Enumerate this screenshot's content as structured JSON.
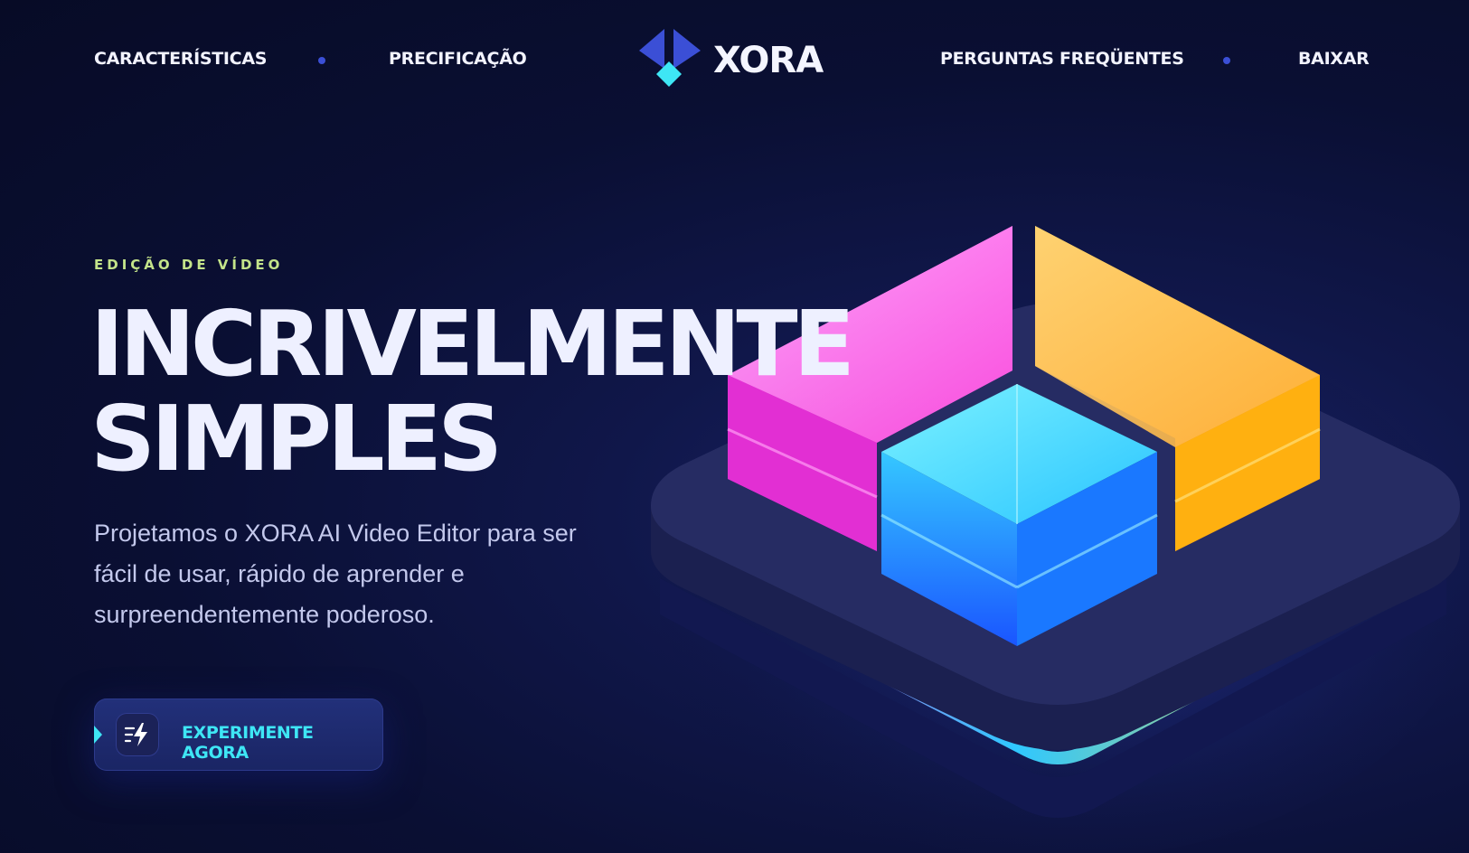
{
  "nav": {
    "links": [
      {
        "label": "CARACTERÍSTICAS"
      },
      {
        "label": "PRECIFICAÇÃO"
      },
      {
        "label": "PERGUNTAS FREQÜENTES"
      },
      {
        "label": "BAIXAR"
      }
    ],
    "logo_text": "XORA"
  },
  "hero": {
    "eyebrow": "EDIÇÃO DE VÍDEO",
    "headline_line1": "INCRIVELMENTE",
    "headline_line2": "SIMPLES",
    "subtitle": "Projetamos o XORA AI Video Editor para ser fácil de usar, rápido de aprender e surpreendentemente poderoso.",
    "cta_label": "EXPERIMENTE AGORA",
    "cta_icon": "lightning-bolt-icon"
  },
  "colors": {
    "background": "#0a0f33",
    "accent_cyan": "#3ee6f5",
    "accent_blue": "#3b4fd6",
    "eyebrow_green": "#c4e48a",
    "block_pink": "#ff3ee0",
    "block_orange": "#ffb52e",
    "block_cyan": "#2fc8ff"
  }
}
